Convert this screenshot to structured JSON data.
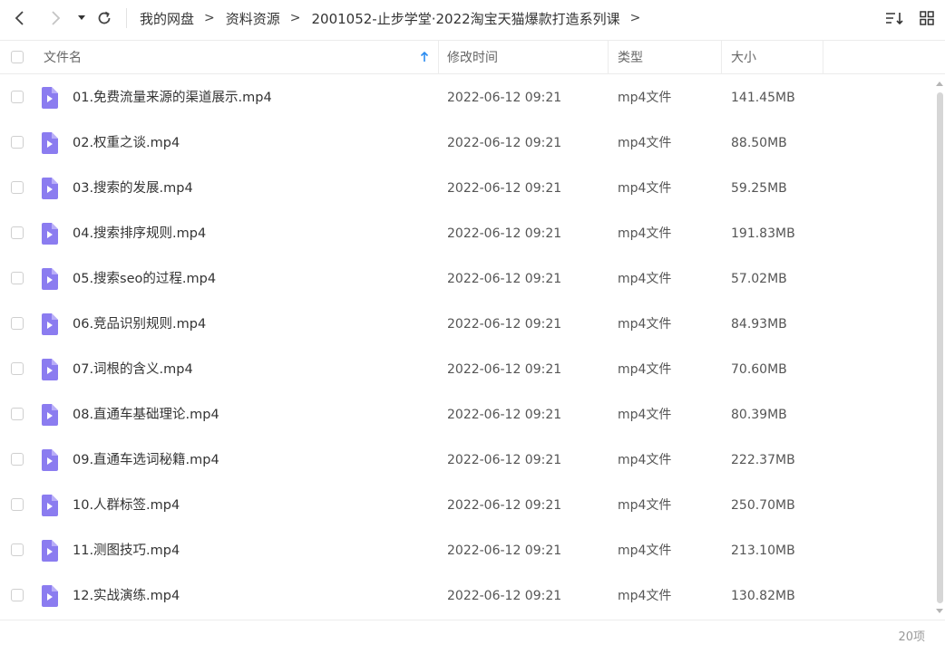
{
  "nav": {
    "breadcrumbs": [
      "我的网盘",
      "资料资源",
      "2001052-止步学堂·2022淘宝天猫爆款打造系列课"
    ],
    "separator": ">"
  },
  "icons": {
    "back": "chevron-left-icon",
    "forward": "chevron-right-icon",
    "dropdown": "caret-down-icon",
    "refresh": "refresh-icon",
    "sort": "sort-icon",
    "grid_view": "grid-view-icon",
    "file": "video-file-icon",
    "sort_arrow": "arrow-up-icon"
  },
  "colors": {
    "file_icon": "#8b7cf0",
    "sort_arrow": "#2b8cf0",
    "scrollbar": "#d6d6d6"
  },
  "columns": {
    "name": "文件名",
    "modified": "修改时间",
    "type": "类型",
    "size": "大小"
  },
  "files": [
    {
      "name": "01.免费流量来源的渠道展示.mp4",
      "modified": "2022-06-12 09:21",
      "type": "mp4文件",
      "size": "141.45MB"
    },
    {
      "name": "02.权重之谈.mp4",
      "modified": "2022-06-12 09:21",
      "type": "mp4文件",
      "size": "88.50MB"
    },
    {
      "name": "03.搜索的发展.mp4",
      "modified": "2022-06-12 09:21",
      "type": "mp4文件",
      "size": "59.25MB"
    },
    {
      "name": "04.搜索排序规则.mp4",
      "modified": "2022-06-12 09:21",
      "type": "mp4文件",
      "size": "191.83MB"
    },
    {
      "name": "05.搜索seo的过程.mp4",
      "modified": "2022-06-12 09:21",
      "type": "mp4文件",
      "size": "57.02MB"
    },
    {
      "name": "06.竞品识别规则.mp4",
      "modified": "2022-06-12 09:21",
      "type": "mp4文件",
      "size": "84.93MB"
    },
    {
      "name": "07.词根的含义.mp4",
      "modified": "2022-06-12 09:21",
      "type": "mp4文件",
      "size": "70.60MB"
    },
    {
      "name": "08.直通车基础理论.mp4",
      "modified": "2022-06-12 09:21",
      "type": "mp4文件",
      "size": "80.39MB"
    },
    {
      "name": "09.直通车选词秘籍.mp4",
      "modified": "2022-06-12 09:21",
      "type": "mp4文件",
      "size": "222.37MB"
    },
    {
      "name": "10.人群标签.mp4",
      "modified": "2022-06-12 09:21",
      "type": "mp4文件",
      "size": "250.70MB"
    },
    {
      "name": "11.测图技巧.mp4",
      "modified": "2022-06-12 09:21",
      "type": "mp4文件",
      "size": "213.10MB"
    },
    {
      "name": "12.实战演练.mp4",
      "modified": "2022-06-12 09:21",
      "type": "mp4文件",
      "size": "130.82MB"
    }
  ],
  "footer": {
    "item_count": "20项"
  }
}
